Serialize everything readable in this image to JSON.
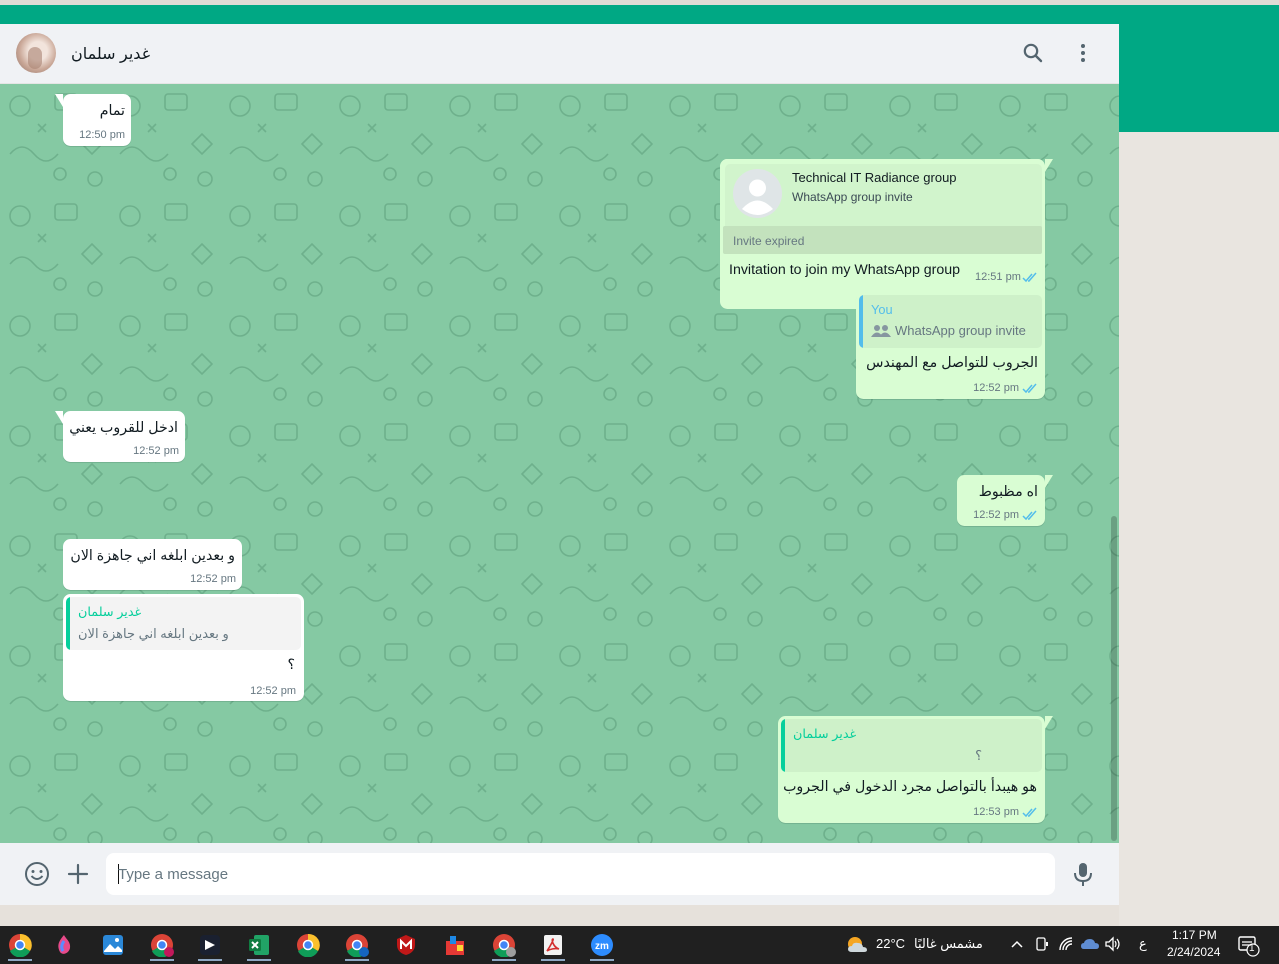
{
  "colors": {
    "brand": "#00a884",
    "chat_background": "#85c9a3",
    "incoming_bubble": "#ffffff",
    "outgoing_bubble": "#d9fdd3",
    "read_ticks": "#53bdeb",
    "quote_bar_green": "#06cf9c",
    "quote_bar_blue": "#53bdeb"
  },
  "header": {
    "contact_name": "غدير سلمان",
    "search_icon": "search-icon",
    "menu_icon": "kebab-menu-icon"
  },
  "messages": {
    "m1": {
      "text": "تمام",
      "time": "12:50 pm"
    },
    "m2": {
      "group_name": "Technical IT Radiance group",
      "invite_label": "WhatsApp group invite",
      "status": "Invite expired",
      "text": "Invitation to join my WhatsApp group",
      "time": "12:51 pm"
    },
    "m3": {
      "quote_author": "You",
      "quote_text": "WhatsApp group invite",
      "text": "الجروب للتواصل مع المهندس",
      "time": "12:52 pm"
    },
    "m4": {
      "text": "ادخل للقروب يعني",
      "time": "12:52 pm"
    },
    "m5": {
      "text": "اه مظبوط",
      "time": "12:52 pm"
    },
    "m6": {
      "text": "و بعدين ابلغه اني جاهزة الان",
      "time": "12:52 pm"
    },
    "m7": {
      "quote_author": "غدير سلمان",
      "quote_text": "و بعدين ابلغه اني جاهزة الان",
      "text": "؟",
      "time": "12:52 pm"
    },
    "m8": {
      "quote_author": "غدير سلمان",
      "quote_text": "؟",
      "text": "هو هيبدأ بالتواصل مجرد الدخول في الجروب",
      "time": "12:53 pm"
    }
  },
  "composer": {
    "placeholder": "Type a message",
    "emoji_icon": "emoji-icon",
    "attach_icon": "plus-icon",
    "mic_icon": "microphone-icon"
  },
  "taskbar": {
    "weather_temp": "22°C",
    "weather_text": "مشمس غالبًا",
    "language": "ع",
    "time": "1:17 PM",
    "date": "2/24/2024",
    "notifications_count": "1",
    "apps": [
      "chrome-profile",
      "copilot",
      "photos",
      "chrome-w",
      "capcut",
      "excel",
      "chrome",
      "chrome-w2",
      "mcafee",
      "paint",
      "chrome-profile-2",
      "acrobat",
      "zoom"
    ]
  }
}
